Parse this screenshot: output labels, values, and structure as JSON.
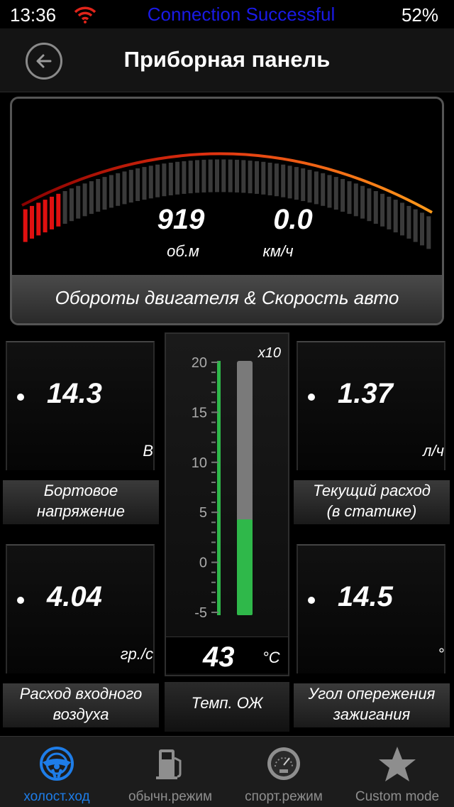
{
  "status": {
    "time": "13:36",
    "message": "Connection Successful",
    "battery": "52%"
  },
  "header": {
    "title": "Приборная панель"
  },
  "gauge": {
    "rpm_value": "919",
    "rpm_unit": "об.м",
    "speed_value": "0.0",
    "speed_unit": "км/ч",
    "caption": "Обороты двигателя & Скорость авто",
    "rpm_fill_fraction": 0.1
  },
  "tiles": {
    "voltage": {
      "value": "14.3",
      "unit": "В",
      "label_line1": "Бортовое",
      "label_line2": "напряжение"
    },
    "fuel_rate": {
      "value": "1.37",
      "unit": "л/ч",
      "label_line1": "Текущий расход",
      "label_line2": "(в статике)"
    },
    "air_flow": {
      "value": "4.04",
      "unit": "гр./с",
      "label_line1": "Расход входного",
      "label_line2": "воздуха"
    },
    "ignition": {
      "value": "14.5",
      "unit": "°",
      "label_line1": "Угол опережения",
      "label_line2": "зажигания"
    }
  },
  "coolant": {
    "multiplier": "x10",
    "scale_labels": [
      "20",
      "15",
      "10",
      "5",
      "0",
      "-5"
    ],
    "scale_min": -5,
    "scale_max": 20,
    "level": 4.3,
    "value": "43",
    "unit": "°C",
    "label": "Темп. ОЖ"
  },
  "tabs": [
    {
      "label": "холост.ход",
      "icon": "steering-wheel-icon",
      "active": true
    },
    {
      "label": "обычн.режим",
      "icon": "fuel-pump-icon",
      "active": false
    },
    {
      "label": "спорт.режим",
      "icon": "speedometer-icon",
      "active": false
    },
    {
      "label": "Custom mode",
      "icon": "star-icon",
      "active": false
    }
  ],
  "colors": {
    "accent": "#1e7de8",
    "gauge_red": "#e01010",
    "gauge_orange": "#ff8c1a",
    "coolant_green": "#2fb84a"
  }
}
